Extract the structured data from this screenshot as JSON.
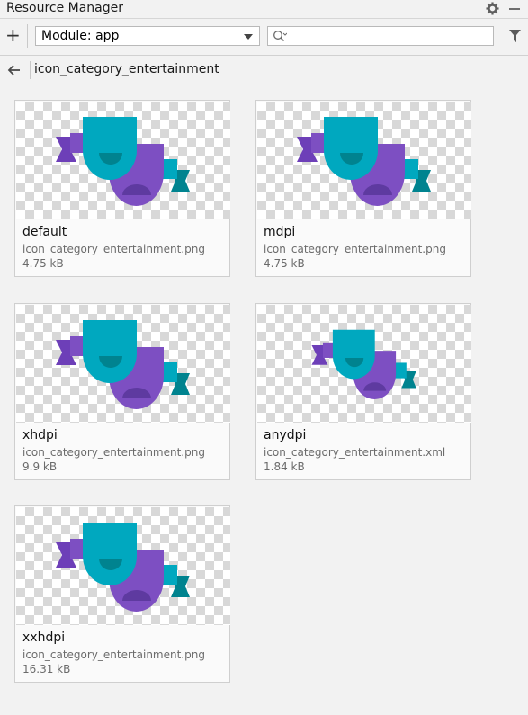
{
  "window": {
    "title": "Resource Manager"
  },
  "toolbar": {
    "add_label": "+",
    "module_select": "Module: app",
    "search_placeholder": ""
  },
  "navigation": {
    "title": "icon_category_entertainment"
  },
  "colors": {
    "mask_teal": "#00a8bf",
    "mask_purple": "#7d4fc2",
    "ribbon_purple": "#6d3fb8",
    "ribbon_teal": "#00a0b2",
    "face_dark_teal": "#00838f",
    "face_dark_purple": "#5e3aa0"
  },
  "resources": [
    {
      "density": "default",
      "file": "icon_category_entertainment.png",
      "size": "4.75 kB"
    },
    {
      "density": "mdpi",
      "file": "icon_category_entertainment.png",
      "size": "4.75 kB"
    },
    {
      "density": "xhdpi",
      "file": "icon_category_entertainment.png",
      "size": "9.9 kB"
    },
    {
      "density": "anydpi",
      "file": "icon_category_entertainment.xml",
      "size": "1.84 kB"
    },
    {
      "density": "xxhdpi",
      "file": "icon_category_entertainment.png",
      "size": "16.31 kB"
    }
  ]
}
